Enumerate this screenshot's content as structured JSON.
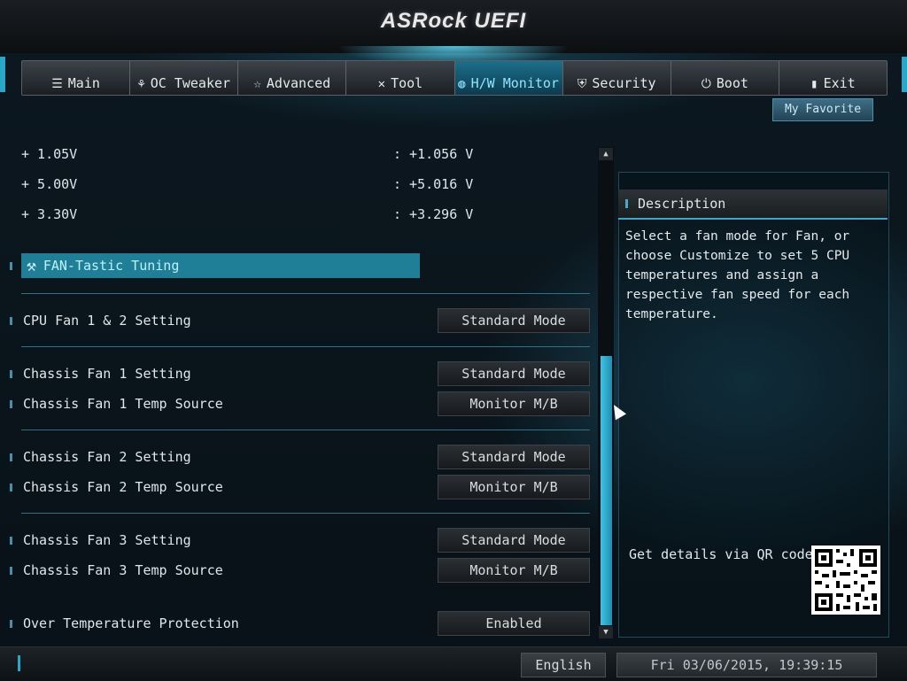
{
  "brand": "ASRock UEFI",
  "nav": {
    "tabs": [
      {
        "label": "Main",
        "icon": "list-icon",
        "glyph": "☰",
        "active": false
      },
      {
        "label": "OC Tweaker",
        "icon": "rocket-icon",
        "glyph": "⚘",
        "active": false
      },
      {
        "label": "Advanced",
        "icon": "star-icon",
        "glyph": "☆",
        "active": false
      },
      {
        "label": "Tool",
        "icon": "tools-icon",
        "glyph": "✕",
        "active": false
      },
      {
        "label": "H/W Monitor",
        "icon": "monitor-icon",
        "glyph": "◍",
        "active": true
      },
      {
        "label": "Security",
        "icon": "shield-icon",
        "glyph": "⛨",
        "active": false
      },
      {
        "label": "Boot",
        "icon": "power-icon",
        "glyph": "⏻",
        "active": false
      },
      {
        "label": "Exit",
        "icon": "exit-icon",
        "glyph": "▮",
        "active": false
      }
    ]
  },
  "favorite_label": "My Favorite",
  "voltages": [
    {
      "label": "+ 1.05V",
      "value": ": +1.056 V"
    },
    {
      "label": "+ 5.00V",
      "value": ": +5.016 V"
    },
    {
      "label": "+ 3.30V",
      "value": ": +3.296 V"
    }
  ],
  "section_title": "FAN-Tastic Tuning",
  "settings": {
    "cpu_fan": {
      "label": "CPU Fan 1 & 2 Setting",
      "value": "Standard Mode"
    },
    "chassis1": {
      "label": "Chassis Fan 1 Setting",
      "value": "Standard Mode"
    },
    "chassis1_src": {
      "label": "Chassis Fan 1 Temp Source",
      "value": "Monitor M/B"
    },
    "chassis2": {
      "label": "Chassis Fan 2 Setting",
      "value": "Standard Mode"
    },
    "chassis2_src": {
      "label": "Chassis Fan 2 Temp Source",
      "value": "Monitor M/B"
    },
    "chassis3": {
      "label": "Chassis Fan 3 Setting",
      "value": "Standard Mode"
    },
    "chassis3_src": {
      "label": "Chassis Fan 3 Temp Source",
      "value": "Monitor M/B"
    },
    "over_temp": {
      "label": "Over Temperature Protection",
      "value": "Enabled"
    }
  },
  "description": {
    "title": "Description",
    "text": "Select a fan mode for Fan, or choose Customize to set 5 CPU temperatures and assign a respective fan speed for each temperature.",
    "qr_label": "Get details via QR code"
  },
  "footer": {
    "language": "English",
    "datetime": "Fri 03/06/2015, 19:39:15"
  },
  "colors": {
    "accent": "#2aa6c8",
    "active_tab": "#1c6f8c",
    "section_bar": "#1e7f97"
  }
}
